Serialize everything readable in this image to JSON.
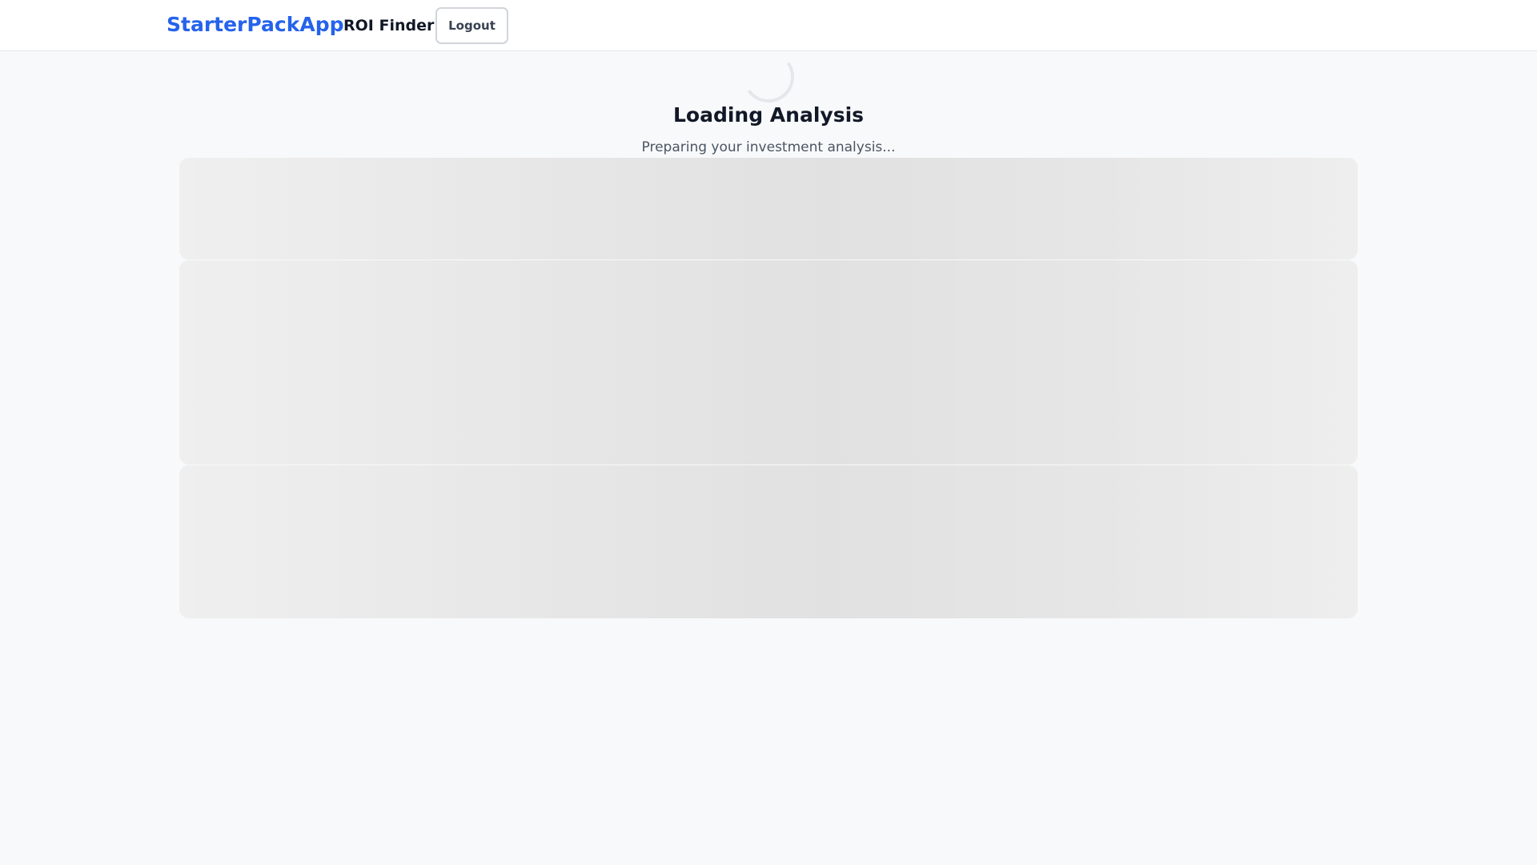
{
  "header": {
    "brand": "StarterPackApp",
    "app_name": "ROI Finder",
    "logout_label": "Logout"
  },
  "loading": {
    "title": "Loading Analysis",
    "subtitle": "Preparing your investment analysis..."
  },
  "colors": {
    "brand": "#2563eb",
    "background": "#f8f9fa",
    "skeleton": "#e3e3e3"
  }
}
